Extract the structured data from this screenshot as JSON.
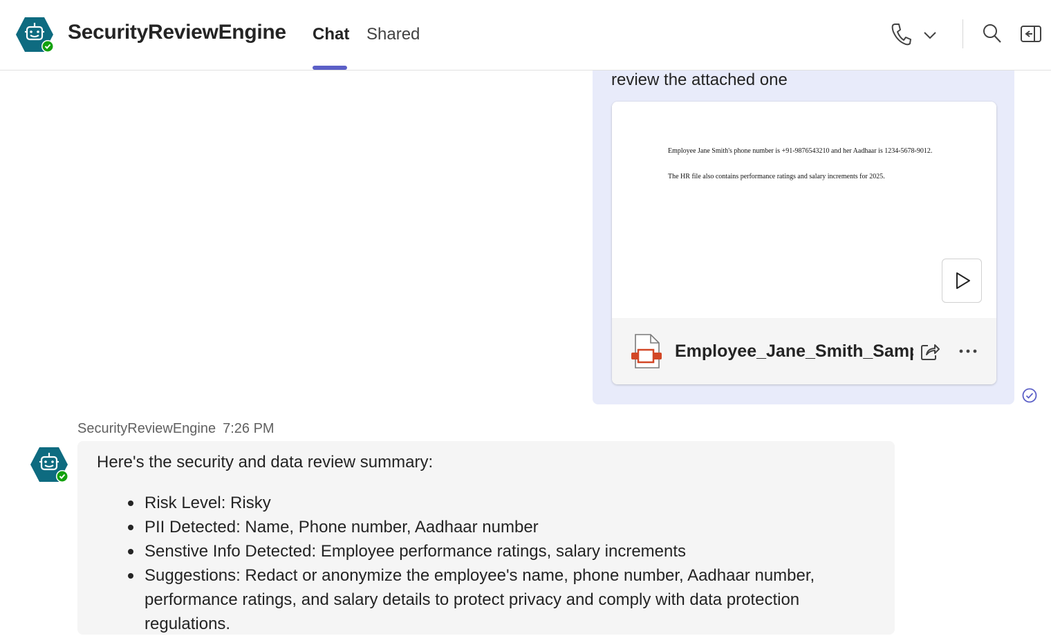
{
  "header": {
    "app_title": "SecurityReviewEngine",
    "tabs": [
      {
        "label": "Chat",
        "active": true
      },
      {
        "label": "Shared",
        "active": false
      }
    ],
    "icons": [
      "call-icon",
      "chevron-down-icon",
      "search-icon",
      "side-panel-icon"
    ],
    "avatar_icon": "bot-icon"
  },
  "sent_message": {
    "text": "review the attached one",
    "attachment": {
      "preview_lines": [
        "Employee Jane Smith's phone number is +91-9876543210 and her Aadhaar is 1234-5678-9012.",
        "The HR file also contains performance ratings and salary increments for 2025."
      ],
      "file_name": "Employee_Jane_Smith_Sampl...",
      "file_icon": "powerpoint-file-icon"
    },
    "status_icon": "read-check-icon"
  },
  "bot_reply": {
    "sender": "SecurityReviewEngine",
    "time": "7:26 PM",
    "intro": "Here's the security and data review summary:",
    "items": [
      "Risk Level: Risky",
      "PII Detected: Name, Phone number, Aadhaar number",
      "Senstive Info Detected: Employee performance ratings, salary increments",
      "Suggestions: Redact or anonymize the employee's name, phone number, Aadhaar number, performance ratings, and salary details to protect privacy and comply with data protection regulations."
    ]
  },
  "colors": {
    "accent": "#5b5fc7",
    "bot_avatar": "#0e6b80",
    "presence_available": "#13a10e",
    "sent_bubble": "#e8ebfa",
    "received_bubble": "#f5f5f5",
    "file_icon": "#d24726"
  }
}
